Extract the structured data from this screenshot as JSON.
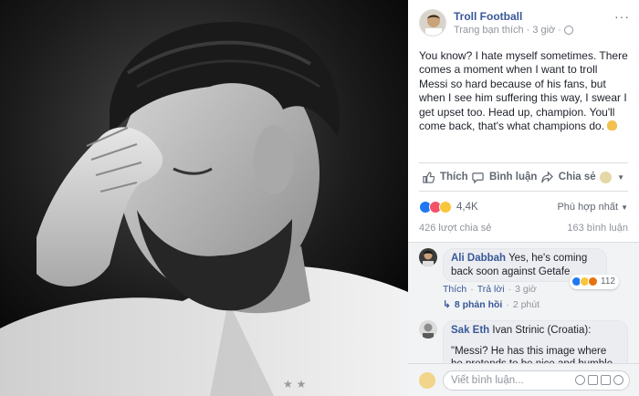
{
  "post": {
    "page_name": "Troll Football",
    "liked_label": "Trang bạn thích",
    "time": "3 giờ",
    "body": "You know? I hate myself sometimes. There comes a moment when I want to troll Messi so hard because of his fans, but when I see him suffering this way, I swear I get upset too. Head up, champion. You'll come back, that's what champions do."
  },
  "actions": {
    "like": "Thích",
    "comment": "Bình luận",
    "share": "Chia sẻ"
  },
  "stats": {
    "reactions": "4,4K",
    "sort": "Phù hợp nhất",
    "shares": "426 lượt chia sẻ",
    "comments": "163 bình luận"
  },
  "comments": [
    {
      "name": "Ali Dabbah",
      "text": "Yes, he's coming back soon against Getafe",
      "like": "Thích",
      "reply": "Trả lời",
      "time": "3 giờ",
      "reactions": "112",
      "replies": "8 phản hồi",
      "replies_time": "2 phút"
    },
    {
      "name": "Sak Eth",
      "text_first": "Ivan Strinic (Croatia):",
      "text_second": "\"Messi? He has this image where he pretends to be nice and humble but he's totally the opposite, not only did he hit"
    }
  ],
  "compose": {
    "placeholder": "Viết bình luận..."
  },
  "colors": {
    "link": "#385898",
    "like": "#2078f4",
    "love": "#f25268",
    "haha": "#f7c63b"
  }
}
